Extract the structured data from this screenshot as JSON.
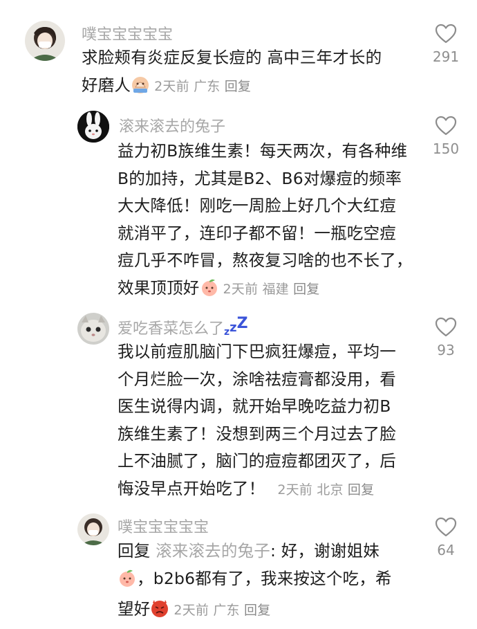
{
  "comments": [
    {
      "name": "噗宝宝宝宝宝",
      "lines": [
        "求脸颊有炎症反复长痘的 高中三年才长的",
        "好磨人"
      ],
      "time": "2天前",
      "location": "广东",
      "reply_label": "回复",
      "likes": "291",
      "avatar_icon": "girl-avatar"
    },
    {
      "name": "滚来滚去的兔子",
      "lines": [
        "益力初B族维生素！每天两次，有各种维",
        "B的加持，尤其是B2、B6对爆痘的频率",
        "大大降低！刚吃一周脸上好几个大红痘",
        "就消平了，连印子都不留！一瓶吃空痘",
        "痘几乎不咋冒，熬夜复习啥的也不长了，",
        "效果顶顶好"
      ],
      "time": "2天前",
      "location": "福建",
      "reply_label": "回复",
      "likes": "150",
      "avatar_icon": "bunny-avatar"
    },
    {
      "name": "爱吃香菜怎么了",
      "name_suffix": "z",
      "name_suffix2": "z",
      "name_suffix3": "Z",
      "lines": [
        "我以前痘肌脑门下巴疯狂爆痘，平均一",
        "个月烂脸一次，涂啥祛痘膏都没用，看",
        "医生说得内调，就开始早晚吃益力初B",
        "族维生素了！没想到两三个月过去了脸",
        "上不油腻了，脑门的痘痘都团灭了，后",
        "悔没早点开始吃了！"
      ],
      "time": "2天前",
      "location": "北京",
      "reply_label": "回复",
      "likes": "93",
      "avatar_icon": "cat-avatar"
    },
    {
      "name": "噗宝宝宝宝宝",
      "reply_prefix": "回复",
      "reply_to": "滚来滚去的兔子",
      "lines": [
        "好，谢谢姐妹",
        "，b2b6都有了，我来按这个吃，希",
        "望好"
      ],
      "time": "2天前",
      "location": "广东",
      "reply_label": "回复",
      "likes": "64",
      "avatar_icon": "girl-avatar"
    }
  ],
  "colors": {
    "name": "#a7a7a7",
    "text": "#1d1d1d",
    "meta": "#9b9b9b",
    "heart_outline": "#8c8c8c"
  },
  "icons": [
    "heart-outline-icon",
    "pray-emoji-icon",
    "peach-face-emoji-icon",
    "angry-devil-emoji-icon",
    "sleep-zzz"
  ]
}
